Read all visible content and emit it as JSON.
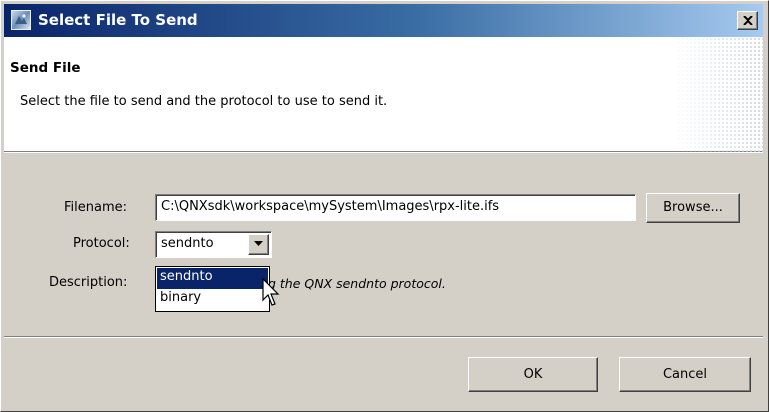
{
  "window": {
    "title": "Select File To Send",
    "title_icon": "app-icon",
    "close_icon": "close-icon"
  },
  "header": {
    "title": "Send File",
    "description": "Select the file to send and the protocol to use to send it."
  },
  "form": {
    "filename_label": "Filename:",
    "filename_value": "C:\\QNXsdk\\workspace\\mySystem\\Images\\rpx-lite.ifs",
    "browse_label": "Browse...",
    "protocol_label": "Protocol:",
    "protocol_value": "sendnto",
    "description_label": "Description:",
    "description_text": "Send the file using the QNX sendnto protocol."
  },
  "protocol_options": [
    {
      "label": "sendnto",
      "selected": true
    },
    {
      "label": "binary",
      "selected": false
    }
  ],
  "buttons": {
    "ok_label": "OK",
    "cancel_label": "Cancel"
  },
  "colors": {
    "title_gradient_start": "#0a246a",
    "title_gradient_end": "#a6caf0",
    "selection": "#0a246a",
    "dialog_bg": "#d4d0c8"
  }
}
